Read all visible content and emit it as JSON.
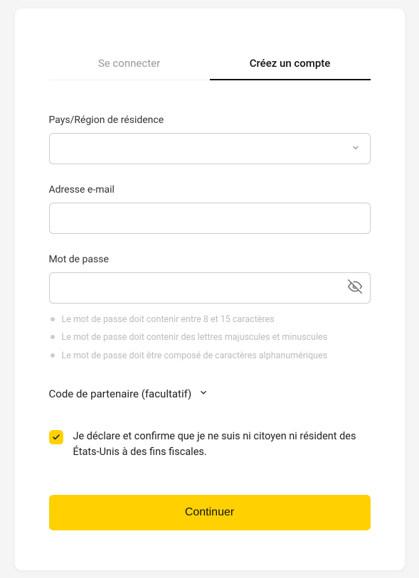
{
  "tabs": {
    "login": "Se connecter",
    "signup": "Créez un compte"
  },
  "form": {
    "country_label": "Pays/Région de résidence",
    "country_value": "",
    "email_label": "Adresse e-mail",
    "email_value": "",
    "password_label": "Mot de passe",
    "password_value": "",
    "rules": [
      "Le mot de passe doit contenir entre 8 et 15 caractères",
      "Le mot de passe doit contenir des lettres majuscules et minuscules",
      "Le mot de passe doit être composé de caractères alphanumériques"
    ],
    "partner_label": "Code de partenaire (facultatif)",
    "declaration_text": "Je déclare et confirme que je ne suis ni citoyen ni résident des États-Unis à des fins fiscales.",
    "declaration_checked": true,
    "submit_label": "Continuer"
  }
}
